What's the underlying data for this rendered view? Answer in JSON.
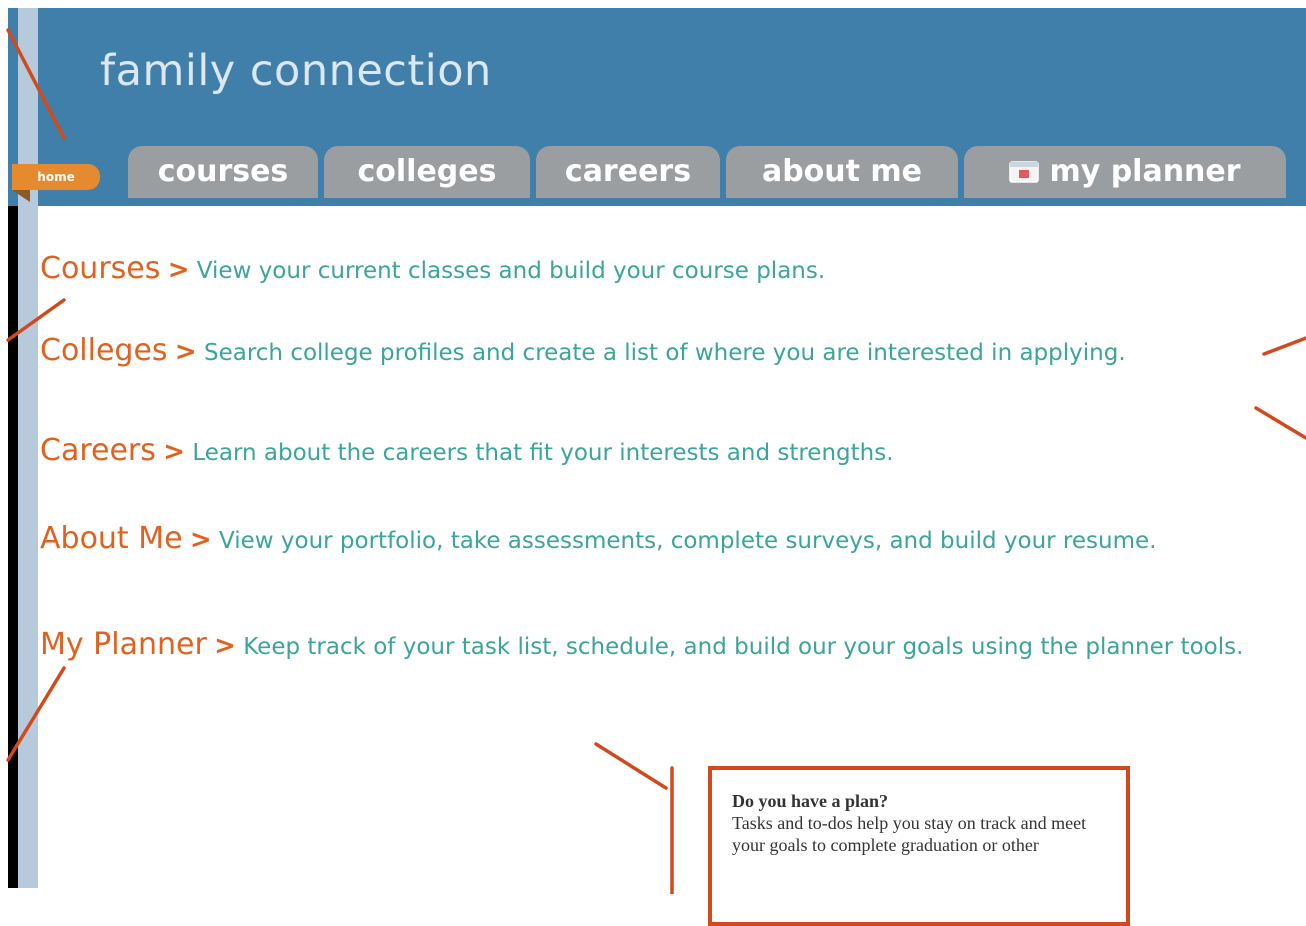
{
  "app": {
    "title": "family connection"
  },
  "tabs": {
    "home": "home",
    "items": [
      {
        "label": "courses"
      },
      {
        "label": "colleges"
      },
      {
        "label": "careers"
      },
      {
        "label": "about me"
      },
      {
        "label": "my planner",
        "icon": "calendar-icon"
      }
    ]
  },
  "sections": [
    {
      "title": "Courses",
      "arrow": ">",
      "description": "View your current classes and build your course plans."
    },
    {
      "title": "Colleges",
      "arrow": ">",
      "description": "Search college profiles and create a list of where you are interested in applying."
    },
    {
      "title": "Careers",
      "arrow": ">",
      "description": "Learn about the careers that fit your interests and strengths."
    },
    {
      "title": "About Me",
      "arrow": ">",
      "description": "View your portfolio, take assessments, complete surveys, and build your resume."
    },
    {
      "title": "My Planner",
      "arrow": ">",
      "description": "Keep track of your task list, schedule, and build our your goals using the planner tools."
    }
  ],
  "callout": {
    "title": "Do you have a plan?",
    "text": "Tasks and to-dos help you stay on track and meet your goals to complete graduation or other"
  },
  "colors": {
    "header": "#3f7fa9",
    "tab": "#9a9ea1",
    "home_tab": "#e58a2e",
    "section_title": "#e0621e",
    "section_text": "#3ba49b",
    "annotation": "#d24a1c"
  }
}
